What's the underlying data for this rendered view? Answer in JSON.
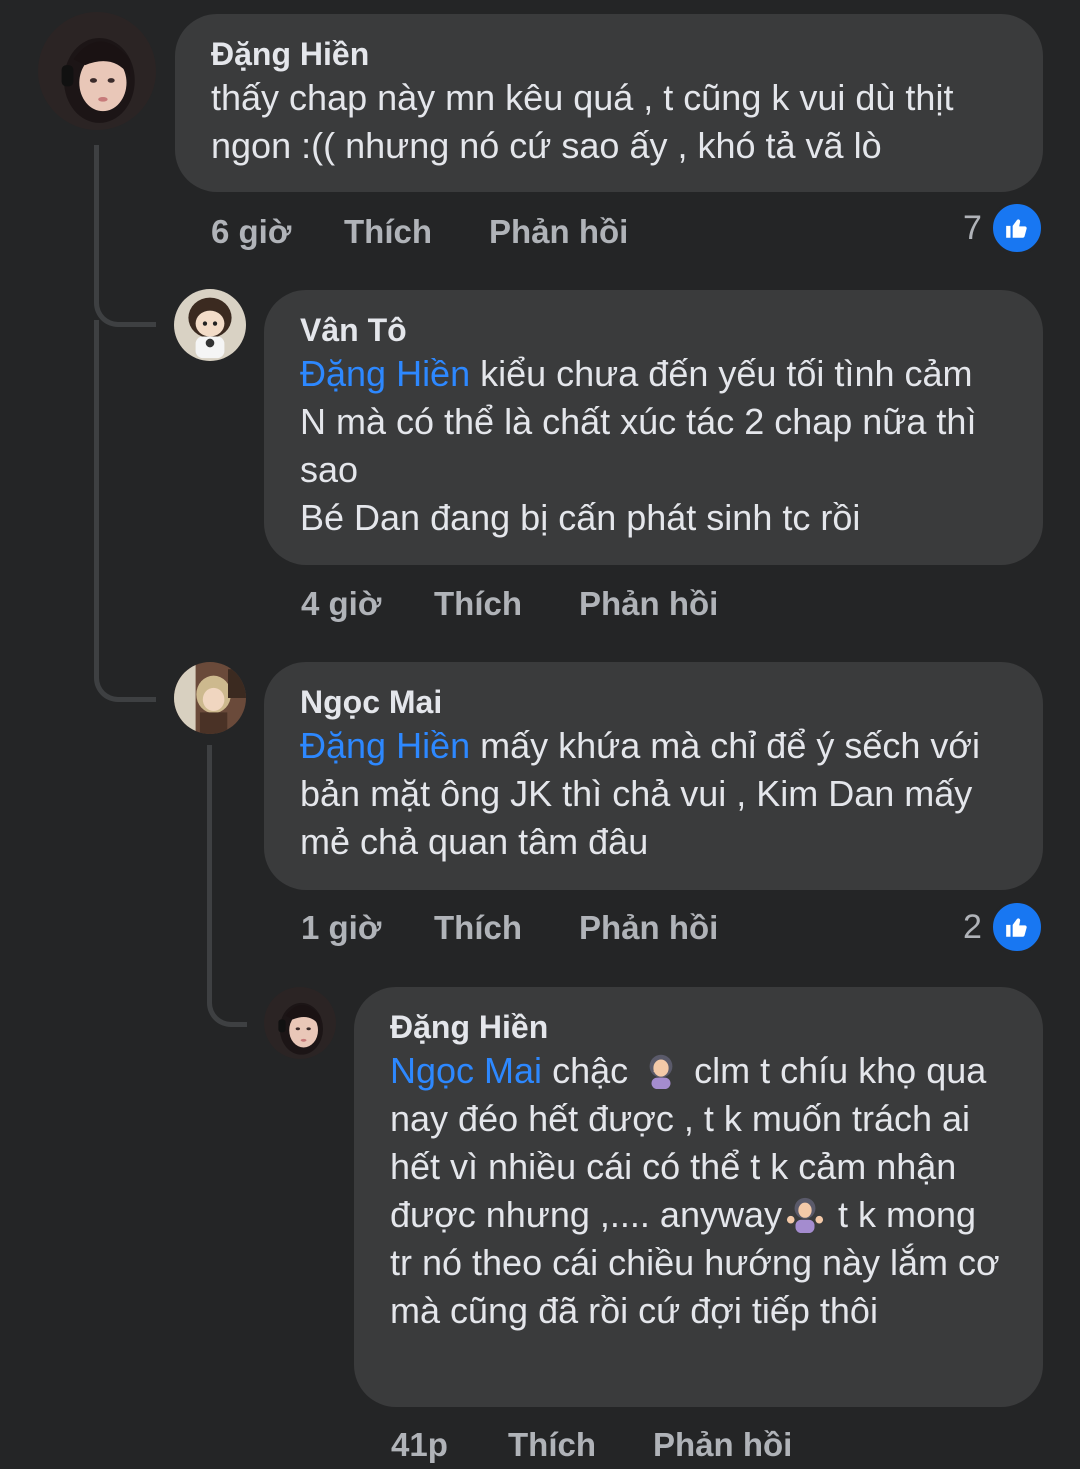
{
  "comments": [
    {
      "author": "Đặng Hiền",
      "mention": "",
      "text": "thấy chap này mn kêu quá , t cũng k vui dù thịt ngon :(( nhưng nó cứ sao ấy , khó tả vã lò",
      "time": "6 giờ",
      "like_label": "Thích",
      "reply_label": "Phản hồi",
      "reaction_count": "7"
    },
    {
      "author": "Vân Tô",
      "mention": "Đặng Hiền",
      "text_line1": " kiểu chưa đến yếu tối tình cảm",
      "text_rest": "N mà có thể là chất xúc tác 2 chap nữa thì sao\nBé Dan đang bị cấn phát sinh tc rồi",
      "time": "4 giờ",
      "like_label": "Thích",
      "reply_label": "Phản hồi"
    },
    {
      "author": "Ngọc Mai",
      "mention": "Đặng Hiền",
      "text": " mấy khứa mà chỉ để ý sếch với bản mặt ông JK thì chả vui ,  Kim Dan mấy mẻ chả quan tâm đâu",
      "time": "1 giờ",
      "like_label": "Thích",
      "reply_label": "Phản hồi",
      "reaction_count": "2"
    },
    {
      "author": "Đặng Hiền",
      "mention": "Ngọc Mai",
      "text_a": " chậc ",
      "text_b": " clm t chíu khọ qua nay đéo hết được , t k muốn trách ai hết vì nhiều cái có thể t k cảm nhận được nhưng ,.... anyway",
      "text_c": " t k mong tr nó theo cái chiều hướng này lắm cơ mà cũng đã rồi cứ đợi tiếp thôi",
      "time": "41p",
      "like_label": "Thích",
      "reply_label": "Phản hồi"
    }
  ],
  "icons": {
    "like": "thumbs-up-icon",
    "facepalm": "woman-facepalming-emoji",
    "shrug": "woman-shrugging-emoji"
  },
  "colors": {
    "background": "#242526",
    "bubble": "#3a3b3c",
    "mention": "#2d88ff",
    "like_badge": "#1877f2"
  }
}
